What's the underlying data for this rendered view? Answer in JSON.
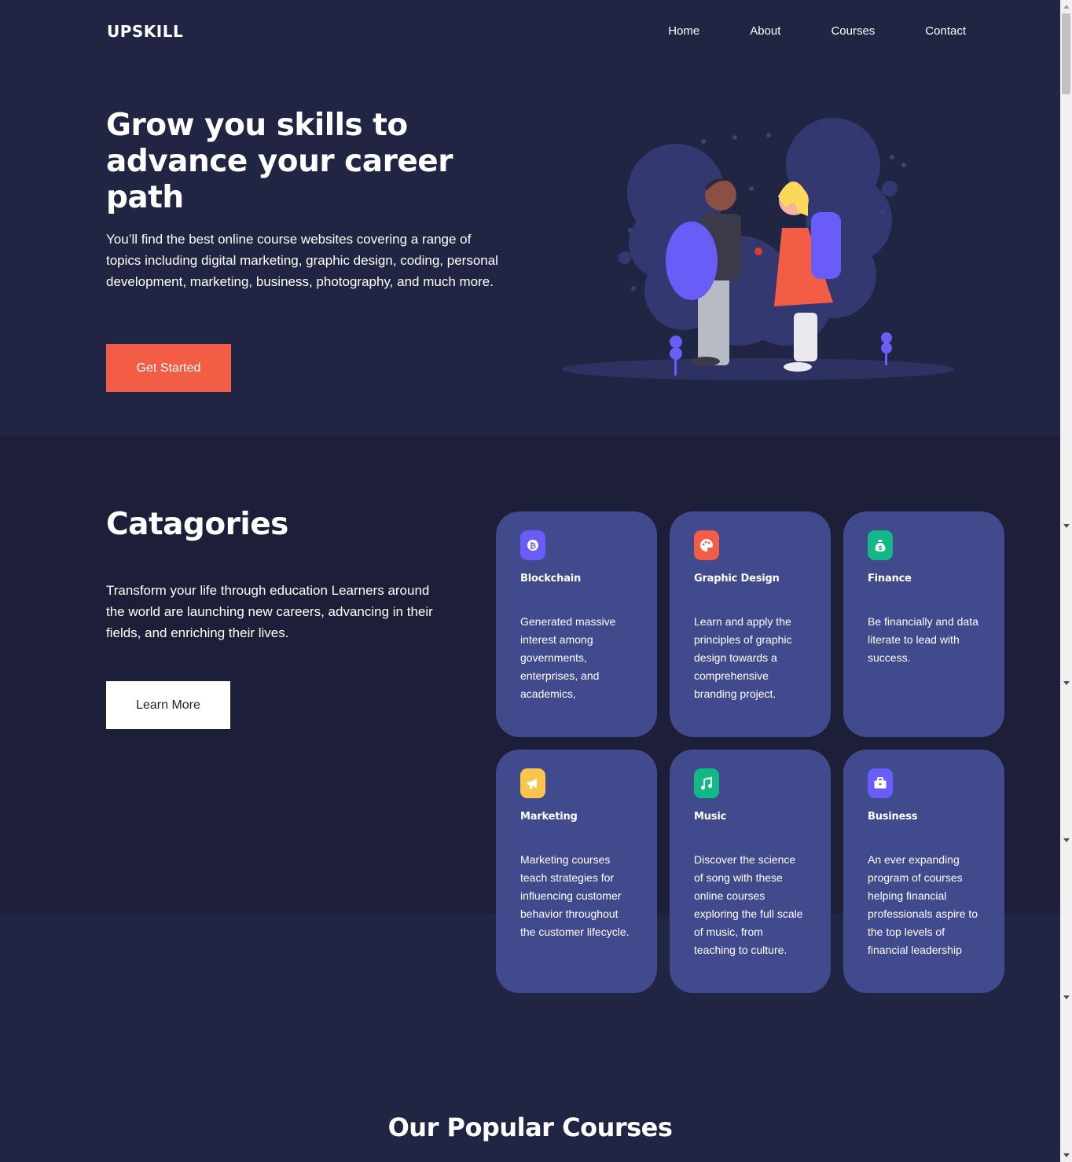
{
  "header": {
    "logo": "UPSKILL",
    "nav": [
      "Home",
      "About",
      "Courses",
      "Contact"
    ]
  },
  "hero": {
    "title": "Grow you skills to advance your career path",
    "text": "You’ll find the best online course websites covering a range of topics including digital marketing, graphic design, coding, personal development, marketing, business, photography, and much more.",
    "cta": "Get Started"
  },
  "categories": {
    "title": "Catagories",
    "text": "Transform your life through education Learners around the world are launching new careers, advancing in their fields, and enriching their lives.",
    "cta": "Learn More",
    "items": [
      {
        "icon": "bitcoin-icon",
        "color": "#6a5cf6",
        "title": "Blockchain",
        "text": "Generated massive interest among governments, enterprises, and academics,"
      },
      {
        "icon": "palette-icon",
        "color": "#f35c45",
        "title": "Graphic Design",
        "text": "Learn and apply the principles of graphic design towards a comprehensive branding project."
      },
      {
        "icon": "money-bag-icon",
        "color": "#12b886",
        "title": "Finance",
        "text": "Be financially and data literate to lead with success."
      },
      {
        "icon": "megaphone-icon",
        "color": "#fbc54d",
        "title": "Marketing",
        "text": "Marketing courses teach strategies for influencing customer behavior throughout the customer lifecycle."
      },
      {
        "icon": "music-note-icon",
        "color": "#12b886",
        "title": "Music",
        "text": "Discover the science of song with these online courses exploring the full scale of music, from teaching to culture."
      },
      {
        "icon": "briefcase-icon",
        "color": "#6a5cf6",
        "title": "Business",
        "text": "An ever expanding program of courses helping financial professionals aspire to the top levels of financial leadership"
      }
    ]
  },
  "popular": {
    "title": "Our Popular Courses"
  },
  "colors": {
    "page_bg": "#212544",
    "section_bg": "#1c1f37",
    "card_bg": "#424a8e",
    "accent": "#f35c45"
  }
}
